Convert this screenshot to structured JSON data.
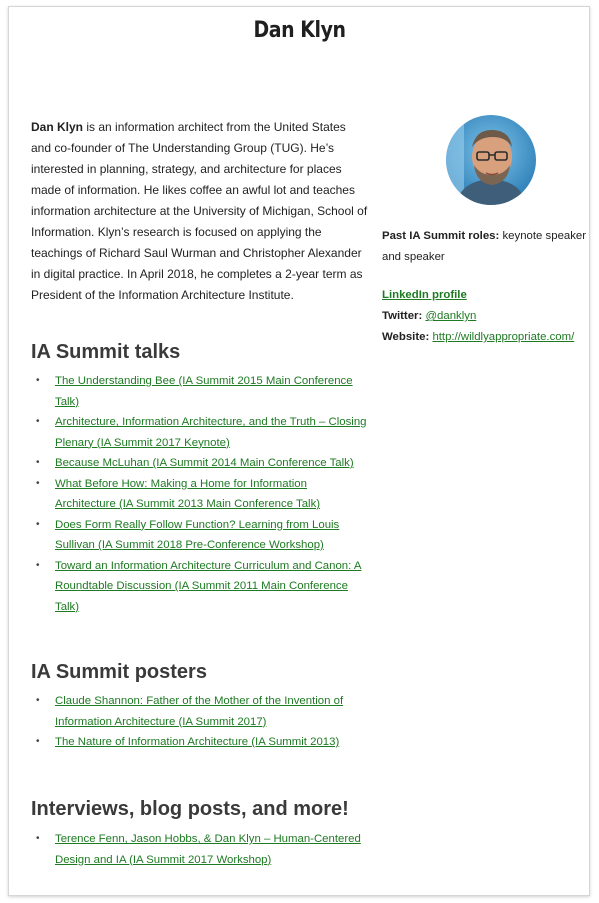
{
  "page": {
    "title": "Dan Klyn"
  },
  "bio": {
    "name": "Dan Klyn",
    "text": " is an information architect from the United States and co-founder of The Understanding Group (TUG). He’s interested in planning, strategy, and architecture for places made of information. He likes coffee an awful lot and teaches information architecture at the University of Michigan, School of Information. Klyn’s research is focused on applying the teachings of Richard Saul Wurman and Christopher Alexander in digital practice. In April 2018, he completes a 2-year term as President of the Information Architecture Institute."
  },
  "sidebar": {
    "roles_label": "Past IA Summit roles:",
    "roles_value": " keynote speaker and speaker",
    "linkedin_label": "LinkedIn profile",
    "twitter_label": "Twitter:",
    "twitter_handle": "@danklyn",
    "website_label": "Website:",
    "website_url": "http://wildlyappropriate.com/"
  },
  "talks": {
    "heading": "IA Summit talks",
    "items": [
      "The Understanding Bee (IA Summit 2015 Main Conference Talk)",
      "Architecture, Information Architecture, and the Truth – Closing Plenary (IA Summit 2017 Keynote)",
      "Because McLuhan (IA Summit 2014 Main Conference Talk)",
      "What Before How: Making a Home for Information Architecture (IA Summit 2013 Main Conference Talk)",
      "Does Form Really Follow Function? Learning from Louis Sullivan (IA Summit 2018 Pre-Conference Workshop)",
      "Toward an Information Architecture Curriculum and Canon: A Roundtable Discussion (IA Summit 2011 Main Conference Talk)"
    ]
  },
  "posters": {
    "heading": "IA Summit posters",
    "items": [
      "Claude Shannon: Father of the Mother of the Invention of Information Architecture (IA Summit 2017)",
      "The Nature of Information Architecture (IA Summit 2013)"
    ]
  },
  "more": {
    "heading": "Interviews, blog posts, and more!",
    "items": [
      "Terence Fenn, Jason Hobbs, & Dan Klyn – Human-Centered Design and IA (IA Summit 2017 Workshop)"
    ]
  },
  "colors": {
    "link": "#1e7a23",
    "heading": "#3a3a3a"
  }
}
